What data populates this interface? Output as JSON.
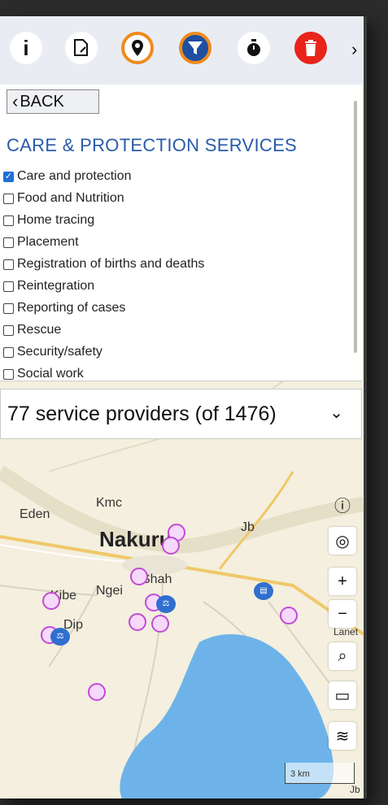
{
  "toolbar": {
    "buttons": [
      {
        "name": "info-icon",
        "glyph": "i"
      },
      {
        "name": "edit-file-icon",
        "glyph": "✎"
      },
      {
        "name": "location-pin-icon",
        "glyph": "●"
      },
      {
        "name": "filter-icon",
        "glyph": "▼"
      },
      {
        "name": "timer-icon",
        "glyph": "⏱"
      },
      {
        "name": "trash-icon",
        "glyph": "🗑"
      }
    ],
    "more_glyph": "›"
  },
  "panel": {
    "back_label": "BACK",
    "title": "CARE & PROTECTION SERVICES",
    "options": [
      {
        "label": "Care and protection",
        "checked": true
      },
      {
        "label": "Food and Nutrition",
        "checked": false
      },
      {
        "label": "Home tracing",
        "checked": false
      },
      {
        "label": "Placement",
        "checked": false
      },
      {
        "label": "Registration of births and deaths",
        "checked": false
      },
      {
        "label": "Reintegration",
        "checked": false
      },
      {
        "label": "Reporting of cases",
        "checked": false
      },
      {
        "label": "Rescue",
        "checked": false
      },
      {
        "label": "Security/safety",
        "checked": false
      },
      {
        "label": "Social work",
        "checked": false
      }
    ]
  },
  "providers": {
    "summary": "77 service providers (of 1476)",
    "toggle_glyph": "⌄"
  },
  "map": {
    "labels": {
      "kmc": "Kmc",
      "eden": "Eden",
      "nakuru": "Nakuru",
      "jb": "Jb",
      "shah": "Shah",
      "ngei": "Ngei",
      "kibe": "Kibe",
      "dip": "Dip",
      "lanet": "Lanet",
      "jb_bottom": "Jb"
    },
    "scale_label": "3 km",
    "controls": [
      "info",
      "locate",
      "zoom-in",
      "zoom-out",
      "search",
      "measure",
      "layers"
    ]
  },
  "colors": {
    "accent": "#2a5aa8",
    "filter_active": "#1e4fa0",
    "pin_orange": "#f08a1b",
    "trash_red": "#e8241b",
    "lake": "#6db3ea"
  }
}
